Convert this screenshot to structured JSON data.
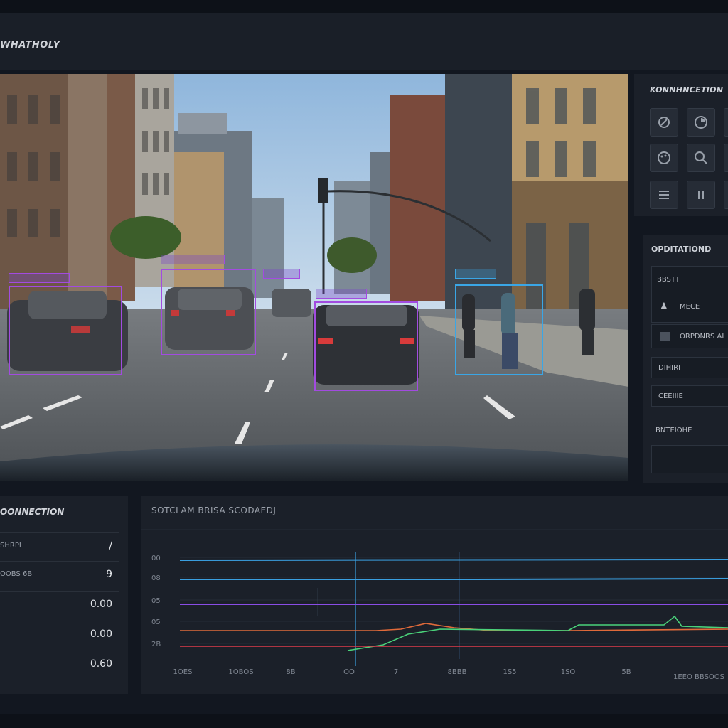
{
  "header": {
    "title": "WHATHOLY"
  },
  "camera": {
    "detections": [
      {
        "label": "",
        "color": "#a24be0"
      },
      {
        "label": "",
        "color": "#a24be0"
      },
      {
        "label": "",
        "color": "#a24be0"
      },
      {
        "label": "",
        "color": "#a24be0"
      },
      {
        "label": "",
        "color": "#a24be0"
      },
      {
        "label": "",
        "color": "#3aa6e6"
      }
    ]
  },
  "tool_panel": {
    "title": "KONNHNCETION",
    "tools": [
      "brush-icon",
      "circle-icon",
      "palette-icon",
      "search-icon",
      "menu-icon",
      "pause-icon"
    ]
  },
  "options_panel": {
    "title": "OPDITATIOND",
    "field1_label": "BBSTT",
    "field1_value": "MECE",
    "field2_value": "ORPDNRS AI",
    "field3_value": "DIHIRI",
    "field4_value": "CEEIIIE",
    "field5_label": "BNTEIOHE"
  },
  "connection_panel": {
    "title": "OONNECTION",
    "rows": [
      {
        "key": "SHRPL",
        "value": "/"
      },
      {
        "key": "OOBS 6B",
        "value": "9"
      },
      {
        "key": "",
        "value": "0.00"
      },
      {
        "key": "",
        "value": "0.00"
      },
      {
        "key": "",
        "value": "0.60"
      }
    ]
  },
  "chart_data": {
    "type": "line",
    "title": "SOTCLAM BRISA SCODAEDJ",
    "y_ticks": [
      "00",
      "08",
      "05",
      "05",
      "2B"
    ],
    "x_ticks": [
      "1OES",
      "1OBOS",
      "8B",
      "OO",
      "7",
      "8BBB",
      "1S5",
      "1SO",
      "5B"
    ],
    "corner_label": "1EEO BBSOOS",
    "colors": {
      "blue": "#3a9fe0",
      "purple": "#8a4de6",
      "orange": "#e06a3a",
      "red": "#e03a4a",
      "green": "#4ad27a"
    }
  }
}
